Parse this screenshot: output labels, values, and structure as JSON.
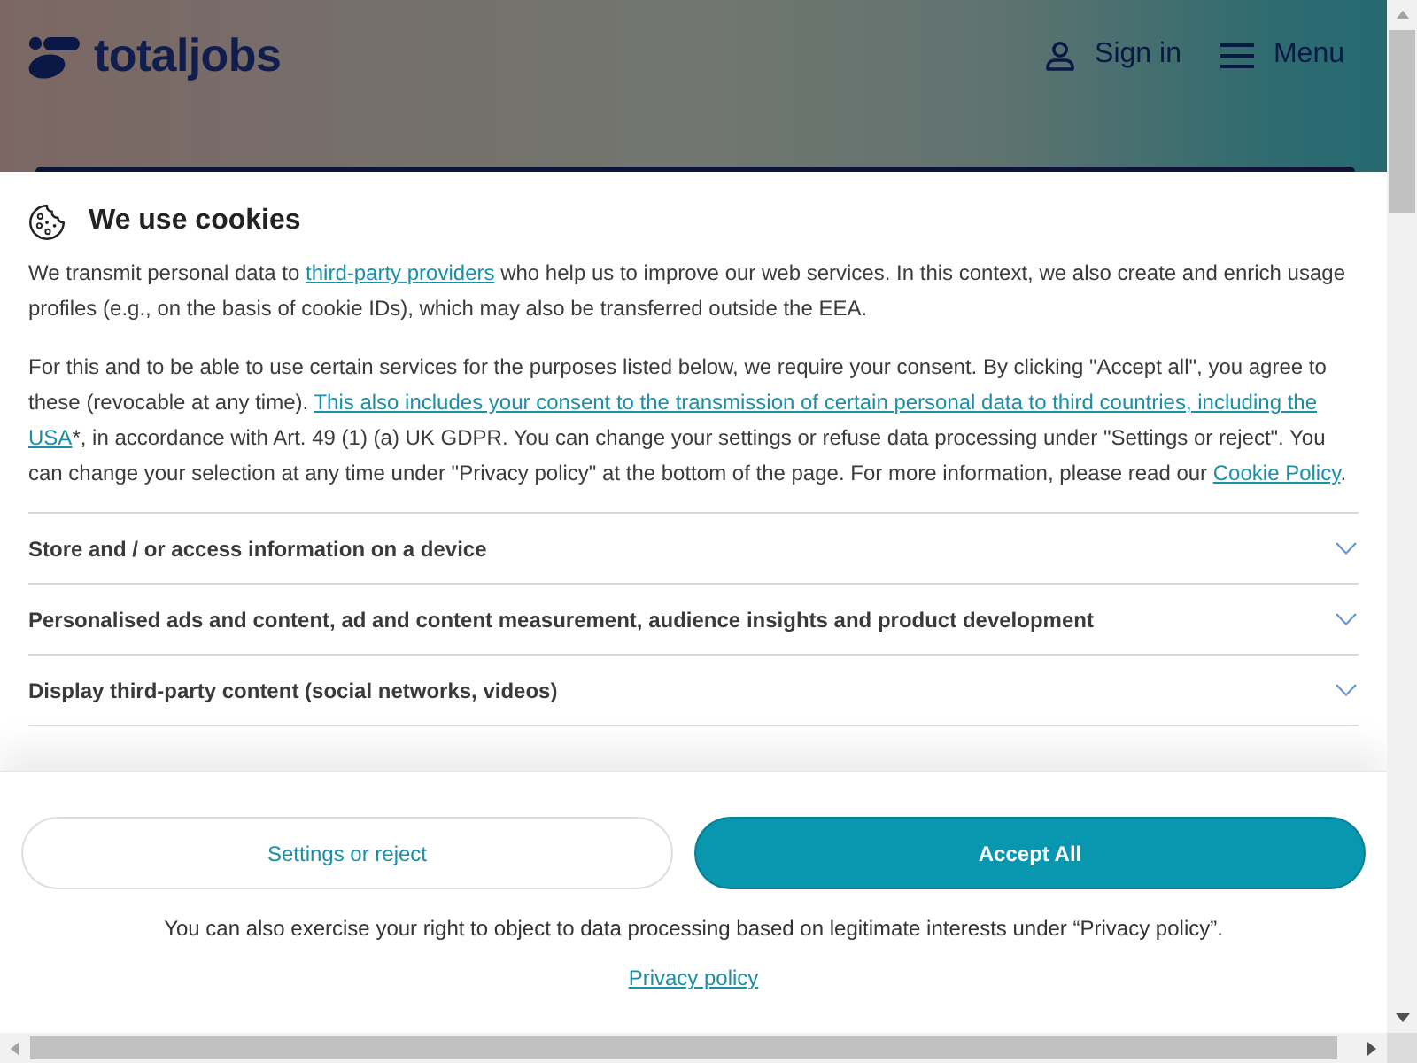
{
  "header": {
    "logo": "totaljobs",
    "nav": [
      {
        "kind": "account",
        "label": "Sign in"
      },
      {
        "kind": "menu",
        "label": "Menu"
      }
    ]
  },
  "cookie_dialog": {
    "title": "We use cookies",
    "paragraphs": [
      [
        {
          "kind": "text",
          "text": "We transmit personal data to "
        },
        {
          "kind": "link",
          "text": "third-party providers"
        },
        {
          "kind": "text",
          "text": " who help us to improve our web services. In this context, we also create and enrich usage profiles (e.g., on the basis of cookie IDs), which may also be transferred outside the EEA."
        }
      ],
      [
        {
          "kind": "text",
          "text": "For this and to be able to use certain services for the purposes listed below, we require your consent. By clicking \"Accept all\", you agree to these (revocable at any time). "
        },
        {
          "kind": "link",
          "text": "This also includes your consent to the transmission of certain personal data to third countries, including the "
        },
        {
          "kind": "link",
          "text": "USA"
        },
        {
          "kind": "text",
          "text": "*, in accordance with Art. 49 (1) (a) UK GDPR. You can change your settings or refuse data processing under \"Settings or reject\". You can change your selection at any time under \"Privacy policy\" at the bottom of the page. For more information, please read our "
        },
        {
          "kind": "link",
          "text": "Cookie Policy"
        },
        {
          "kind": "text",
          "text": "."
        }
      ]
    ],
    "purposes": [
      {
        "label": "Store and / or access information on a device",
        "expanded": false
      },
      {
        "label": "Personalised ads and content, ad and content measurement, audience insights and product development",
        "expanded": false
      },
      {
        "label": "Display third-party content (social networks, videos)",
        "expanded": false
      }
    ],
    "buttons": [
      {
        "kind": "secondary",
        "label": "Settings or reject"
      },
      {
        "kind": "primary",
        "label": "Accept All"
      }
    ],
    "notice": "You can also exercise your right to object to data processing based on legitimate interests under “Privacy policy”.",
    "privacy_link": "Privacy policy"
  }
}
